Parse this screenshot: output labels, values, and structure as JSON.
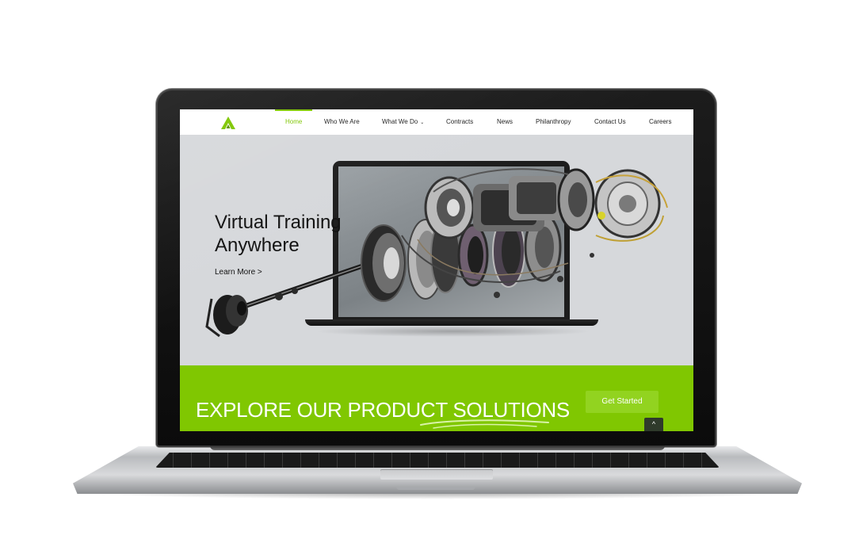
{
  "brand": {
    "accent": "#80c701",
    "logo_icon": "a-logo-icon"
  },
  "nav": {
    "items": [
      {
        "label": "Home",
        "active": true
      },
      {
        "label": "Who We Are"
      },
      {
        "label": "What We Do",
        "caret": "⌄"
      },
      {
        "label": "Contracts"
      },
      {
        "label": "News"
      },
      {
        "label": "Philanthropy"
      },
      {
        "label": "Contact Us"
      },
      {
        "label": "Careers"
      }
    ]
  },
  "hero": {
    "title_line1": "Virtual Training",
    "title_line2": "Anywhere",
    "link": "Learn More >"
  },
  "band": {
    "title": "EXPLORE OUR PRODUCT SOLUTIONS",
    "cta": "Get Started",
    "back_to_top_icon": "^"
  }
}
